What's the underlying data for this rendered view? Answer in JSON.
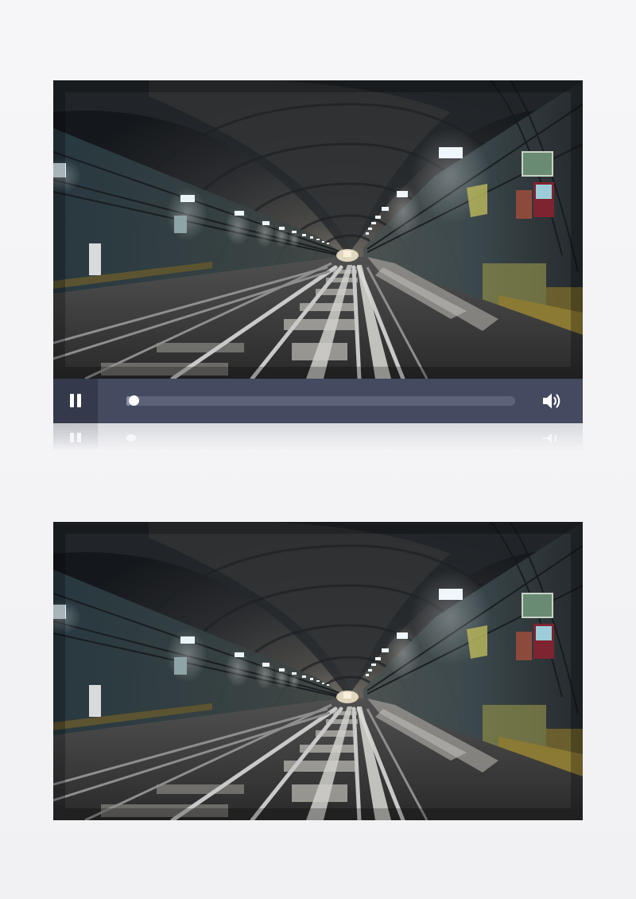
{
  "players": [
    {
      "scene": "subway-tunnel",
      "controls": {
        "state": "playing",
        "play_icon": "pause-icon",
        "volume_icon": "speaker-icon",
        "progress_fraction": 0.01
      }
    },
    {
      "scene": "subway-tunnel"
    }
  ],
  "colors": {
    "control_bar": "#444a5f",
    "play_button_bg": "#343a4b",
    "progress_track": "#5c6278",
    "knob": "#ffffff",
    "page_bg": "#f4f4f6"
  }
}
